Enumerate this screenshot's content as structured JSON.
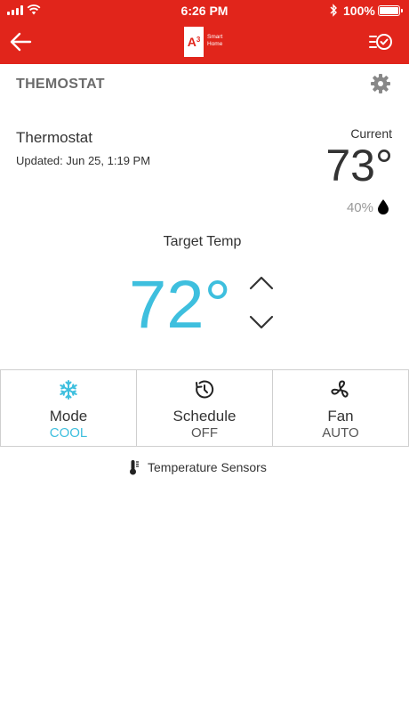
{
  "status_bar": {
    "time": "6:26 PM",
    "battery": "100%"
  },
  "header": {
    "logo_letter": "A",
    "logo_sup": "3",
    "logo_line1": "Smart",
    "logo_line2": "Home"
  },
  "page": {
    "title": "THEMOSTAT"
  },
  "device": {
    "name": "Thermostat",
    "updated": "Updated: Jun 25, 1:19 PM",
    "current_label": "Current",
    "current_temp": "73°",
    "humidity": "40%"
  },
  "target": {
    "label": "Target Temp",
    "value": "72°"
  },
  "controls": {
    "mode": {
      "label": "Mode",
      "value": "COOL"
    },
    "schedule": {
      "label": "Schedule",
      "value": "OFF"
    },
    "fan": {
      "label": "Fan",
      "value": "AUTO"
    }
  },
  "sensors": {
    "label": "Temperature Sensors"
  },
  "colors": {
    "brand": "#e1251b",
    "accent": "#3ebfde"
  }
}
